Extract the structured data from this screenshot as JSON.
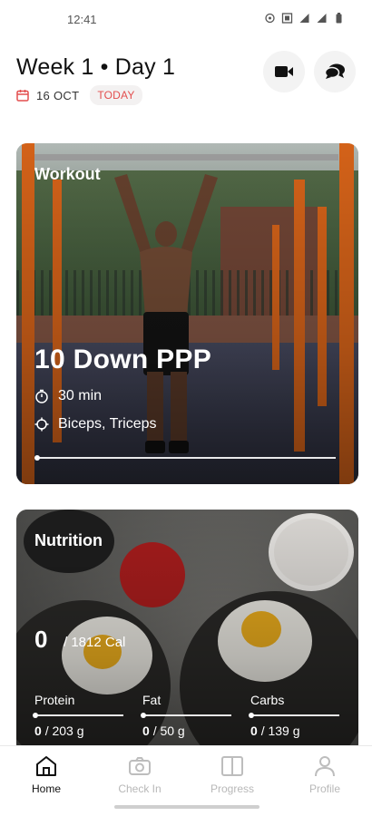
{
  "statusbar": {
    "time": "12:41"
  },
  "header": {
    "title": "Week 1 • Day 1",
    "date": "16 OCT",
    "today_label": "TODAY"
  },
  "workout": {
    "section_label": "Workout",
    "title": "10 Down PPP",
    "duration": "30 min",
    "muscles": "Biceps, Triceps",
    "progress": 0
  },
  "nutrition": {
    "section_label": "Nutrition",
    "calories_current": "0",
    "calories_goal": "/ 1812 Cal",
    "macros": [
      {
        "label": "Protein",
        "current": "0",
        "goal": "/ 203 g"
      },
      {
        "label": "Fat",
        "current": "0",
        "goal": "/ 50 g"
      },
      {
        "label": "Carbs",
        "current": "0",
        "goal": "/ 139 g"
      }
    ]
  },
  "nav": {
    "items": [
      {
        "label": "Home",
        "icon": "home-icon",
        "active": true
      },
      {
        "label": "Check In",
        "icon": "camera-icon",
        "active": false
      },
      {
        "label": "Progress",
        "icon": "progress-book-icon",
        "active": false
      },
      {
        "label": "Profile",
        "icon": "person-icon",
        "active": false
      }
    ]
  },
  "colors": {
    "accent": "#e34f4f",
    "pole": "#e56a1b"
  }
}
